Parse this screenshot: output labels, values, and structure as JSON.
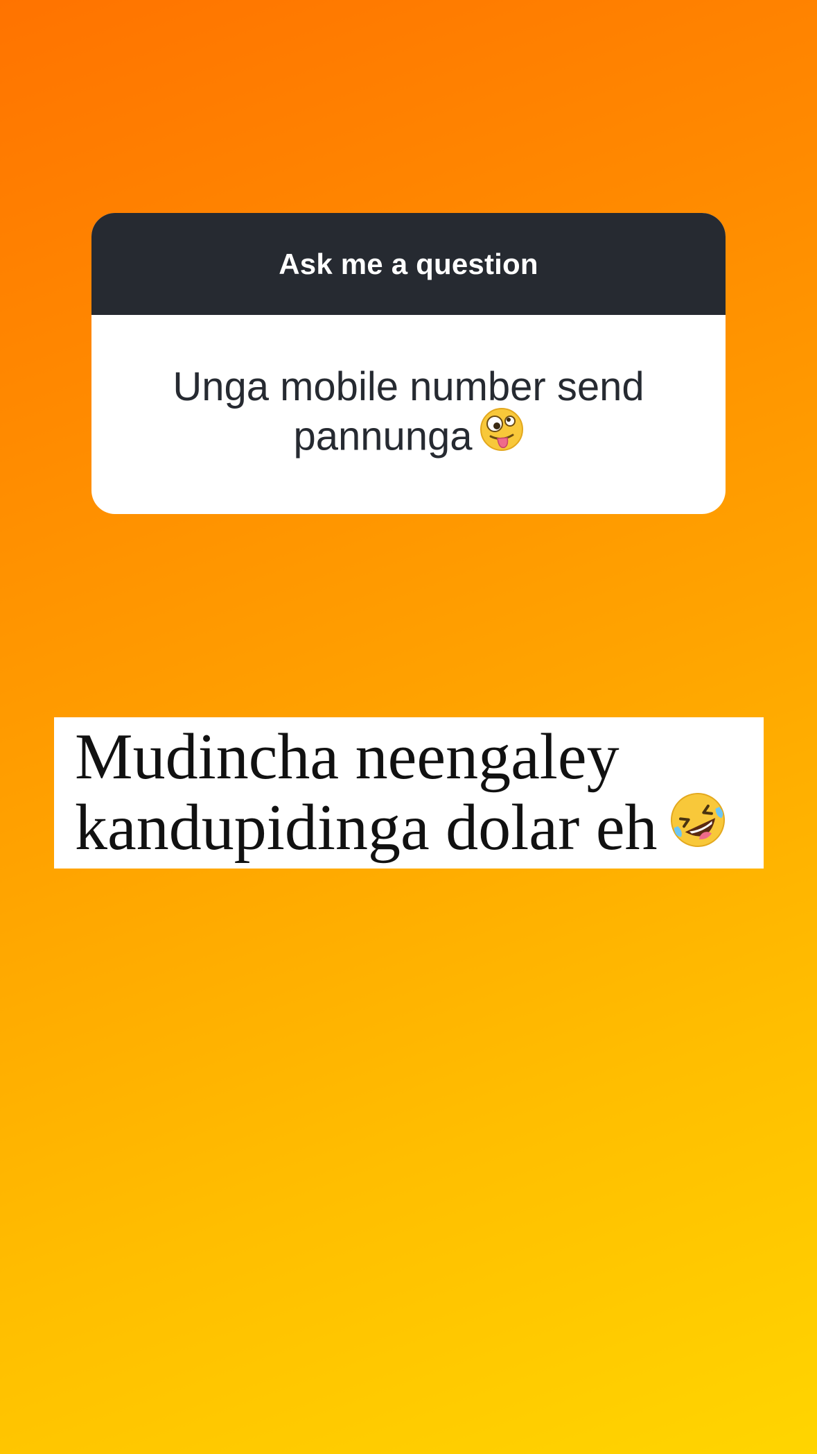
{
  "question_sticker": {
    "title": "Ask me a question",
    "question": "Unga mobile number send pannunga",
    "question_emoji": "zany-face-icon"
  },
  "answer": {
    "line1": "Mudincha neengaley",
    "line2": "kandupidinga dolar eh",
    "emoji": "rolling-on-floor-laughing-icon"
  },
  "colors": {
    "background_gradient_start": "#ff7300",
    "background_gradient_end": "#ffd500",
    "card_header": "#262a31",
    "card_body": "#ffffff",
    "question_text": "#262a31",
    "answer_text": "#111111"
  }
}
